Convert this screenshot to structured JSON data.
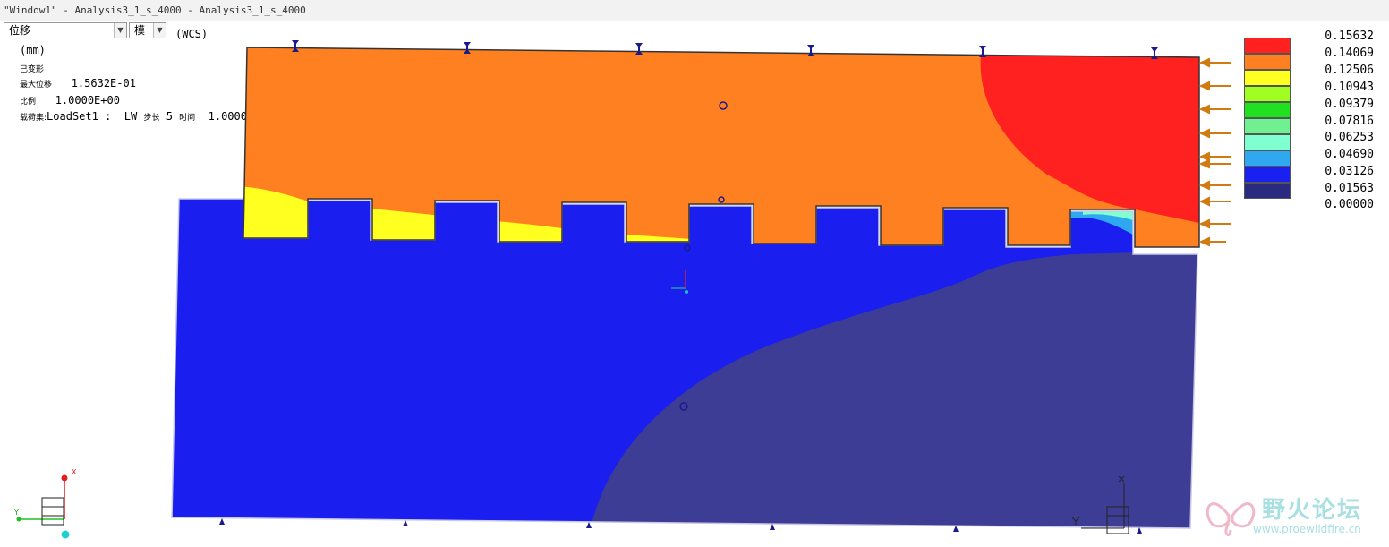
{
  "window": {
    "title": "\"Window1\" - Analysis3_1_s_4000 - Analysis3_1_s_4000"
  },
  "toolbar": {
    "quantity_select": "位移",
    "mode_select": "模"
  },
  "view": {
    "coordinate_system": "(WCS)",
    "units": "(mm)",
    "deformed_label": "已变形",
    "max_disp_label": "最大位移",
    "max_disp_value": "1.5632E-01",
    "scale_label": "比例",
    "scale_value": "1.0000E+00",
    "loadset_label": "载荷集:",
    "loadset_value": "LoadSet1 :",
    "lw": "LW",
    "step_label": "步长",
    "step_value": "5",
    "time_label": "时间",
    "time_value": "1.0000E+00"
  },
  "legend": {
    "values": [
      "0.15632",
      "0.14069",
      "0.12506",
      "0.10943",
      "0.09379",
      "0.07816",
      "0.06253",
      "0.04690",
      "0.03126",
      "0.01563",
      "0.00000"
    ],
    "colors": [
      "#ff2020",
      "#ff8020",
      "#ffff20",
      "#a0ff20",
      "#20e020",
      "#70f090",
      "#80ffd0",
      "#30a8f0",
      "#1a20f0",
      "#2a2a80"
    ]
  },
  "triad": {
    "x": "X",
    "y": "Y"
  },
  "watermark": {
    "title": "野火论坛",
    "url": "www.proewildfire.cn"
  }
}
